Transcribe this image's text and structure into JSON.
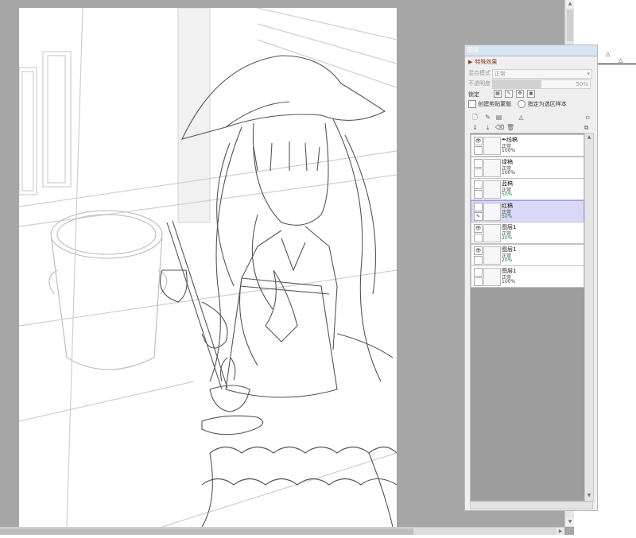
{
  "panel": {
    "title": "图层",
    "effects_label": "特殊效果",
    "blend_mode_label": "混合模式",
    "blend_mode_value": "正常",
    "opacity_label": "不透明度",
    "opacity_value": "50%",
    "opacity_fraction": 0.5,
    "lock_label": "锁定",
    "clip_label": "创建剪贴蒙版",
    "selection_source_label": "指定为选区样本"
  },
  "layers": [
    {
      "name": "线稿",
      "mode": "正常",
      "opacity": "100%",
      "visible": true,
      "selected": false,
      "has_pen_icon": true
    },
    {
      "name": "绿稿",
      "mode": "正常",
      "opacity": "100%",
      "visible": false,
      "selected": false,
      "has_pen_icon": false
    },
    {
      "name": "蓝稿",
      "mode": "正常",
      "opacity": "50%",
      "visible": false,
      "selected": false,
      "has_pen_icon": false
    },
    {
      "name": "红稿",
      "mode": "正常",
      "opacity": "50%",
      "visible": false,
      "selected": true,
      "has_pen_icon": false
    },
    {
      "name": "图层1",
      "mode": "正常",
      "opacity": "20%",
      "visible": true,
      "selected": false,
      "has_pen_icon": false
    },
    {
      "name": "图层1",
      "mode": "正常",
      "opacity": "20%",
      "visible": true,
      "selected": false,
      "has_pen_icon": false
    },
    {
      "name": "图层1",
      "mode": "正常",
      "opacity": "100%",
      "visible": false,
      "selected": false,
      "has_pen_icon": false
    }
  ],
  "colors": {
    "workspace": "#a6a6a6",
    "selected_layer": "#d9d9f7",
    "effects_text": "#8a3a2a",
    "partial_opacity_text": "#2a7f4a"
  }
}
